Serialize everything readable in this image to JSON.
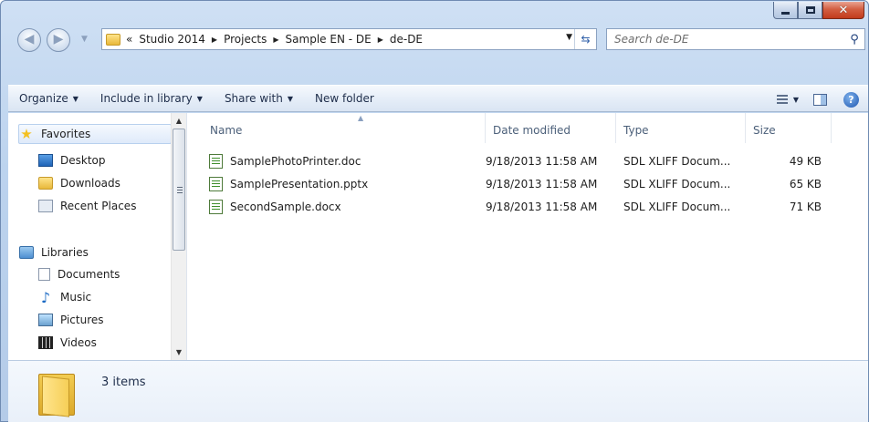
{
  "window": {
    "caption_buttons": {
      "minimize": "minimize-glyph",
      "maximize": "maximize-glyph",
      "close": "✕"
    }
  },
  "address": {
    "crumbs": [
      "«",
      "Studio 2014",
      "Projects",
      "Sample EN - DE",
      "de-DE"
    ],
    "separator": "▶"
  },
  "search": {
    "placeholder": "Search de-DE"
  },
  "commands": {
    "organize": "Organize",
    "include": "Include in library",
    "share": "Share with",
    "new_folder": "New folder",
    "help": "?"
  },
  "nav": {
    "favorites": "Favorites",
    "desktop": "Desktop",
    "downloads": "Downloads",
    "recent": "Recent Places",
    "libraries": "Libraries",
    "documents": "Documents",
    "music": "Music",
    "pictures": "Pictures",
    "videos": "Videos"
  },
  "columns": {
    "name": "Name",
    "date": "Date modified",
    "type": "Type",
    "size": "Size"
  },
  "files": [
    {
      "name": "SamplePhotoPrinter.doc",
      "date": "9/18/2013 11:58 AM",
      "type": "SDL XLIFF Docum...",
      "size": "49 KB"
    },
    {
      "name": "SamplePresentation.pptx",
      "date": "9/18/2013 11:58 AM",
      "type": "SDL XLIFF Docum...",
      "size": "65 KB"
    },
    {
      "name": "SecondSample.docx",
      "date": "9/18/2013 11:58 AM",
      "type": "SDL XLIFF Docum...",
      "size": "71 KB"
    }
  ],
  "details": {
    "count": "3 items"
  }
}
